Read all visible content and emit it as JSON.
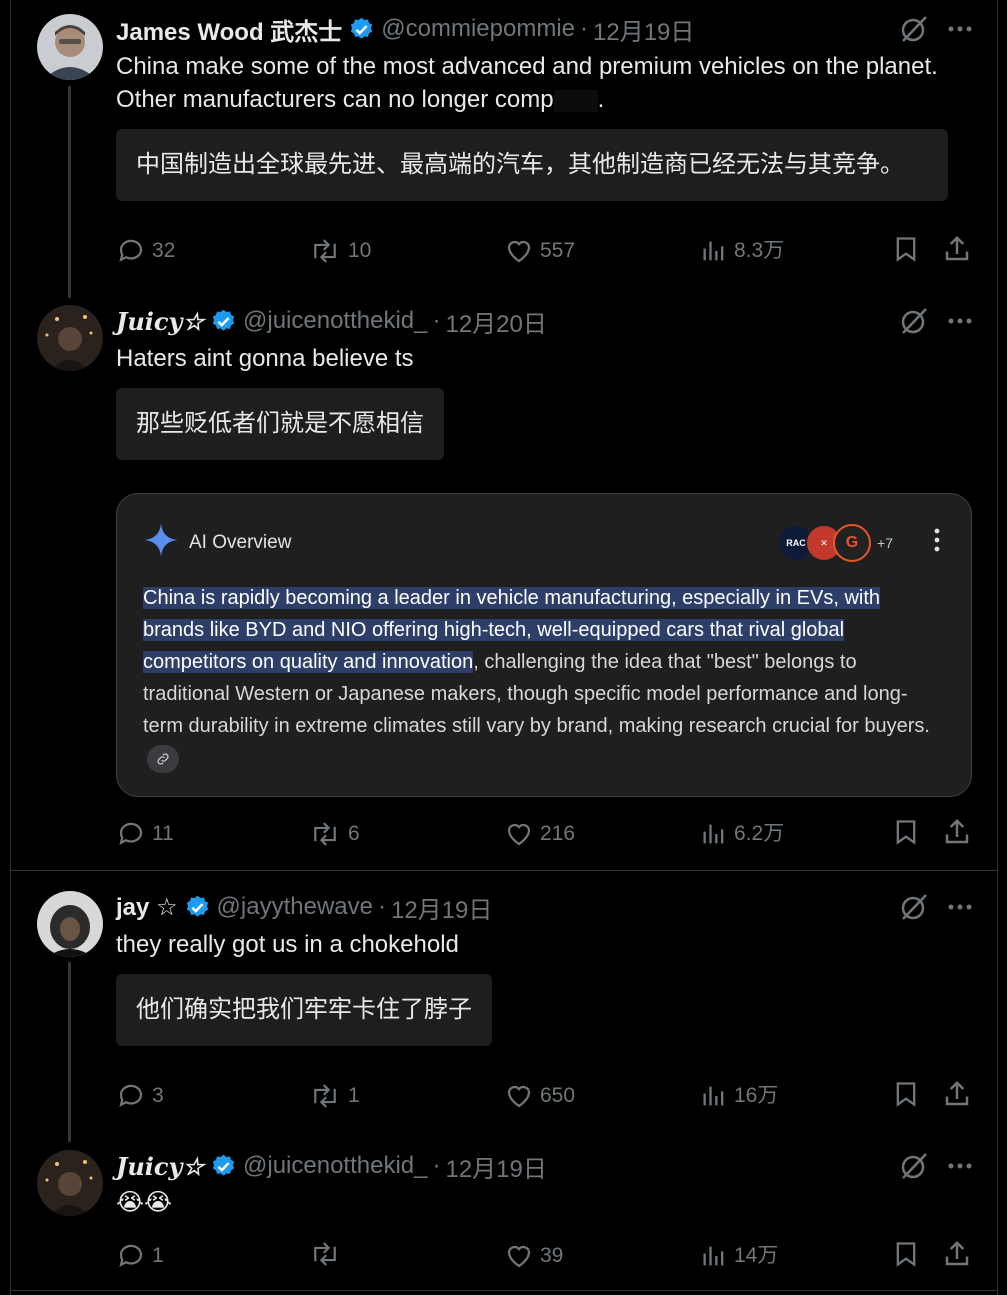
{
  "posts": [
    {
      "name": "James Wood 武杰士",
      "handle": "@commiepommie",
      "date": "12月19日",
      "text": "China make some of the most advanced and premium vehicles on the planet. Other manufacturers can no longer comp",
      "text_tail": ".",
      "translation": "中国制造出全球最先进、最高端的汽车，其他制造商已经无法与其竞争。",
      "replies": "32",
      "reposts": "10",
      "likes": "557",
      "views": "8.3万"
    },
    {
      "name": "Juicy☆",
      "handle": "@juicenotthekid_",
      "date": "12月20日",
      "text": "Haters aint gonna believe ts",
      "translation": "那些贬低者们就是不愿相信",
      "replies": "11",
      "reposts": "6",
      "likes": "216",
      "views": "6.2万"
    },
    {
      "name": "jay ☆",
      "handle": "@jayythewave",
      "date": "12月19日",
      "text": "they really got us in a chokehold",
      "translation": "他们确实把我们牢牢卡住了脖子",
      "replies": "3",
      "reposts": "1",
      "likes": "650",
      "views": "16万"
    },
    {
      "name": "Juicy☆",
      "handle": "@juicenotthekid_",
      "date": "12月19日",
      "text": "😭😭",
      "replies": "1",
      "reposts": "",
      "likes": "39",
      "views": "14万"
    }
  ],
  "ai_overview": {
    "title": "AI Overview",
    "more_sources": "+7",
    "source_rac": "RAC",
    "highlighted": "China is rapidly becoming a leader in vehicle manufacturing, especially in EVs, with brands like BYD and NIO offering high-tech, well-equipped cars that rival global competitors on quality and innovation",
    "rest": ", challenging the idea that \"best\" belongs to traditional Western or Japanese makers, though specific model performance and long-term durability in extreme climates still vary by brand, making research crucial for buyers."
  },
  "colors": {
    "verified": "#1d9bf0",
    "muted": "#71767b",
    "highlight": "#2d3e68"
  }
}
